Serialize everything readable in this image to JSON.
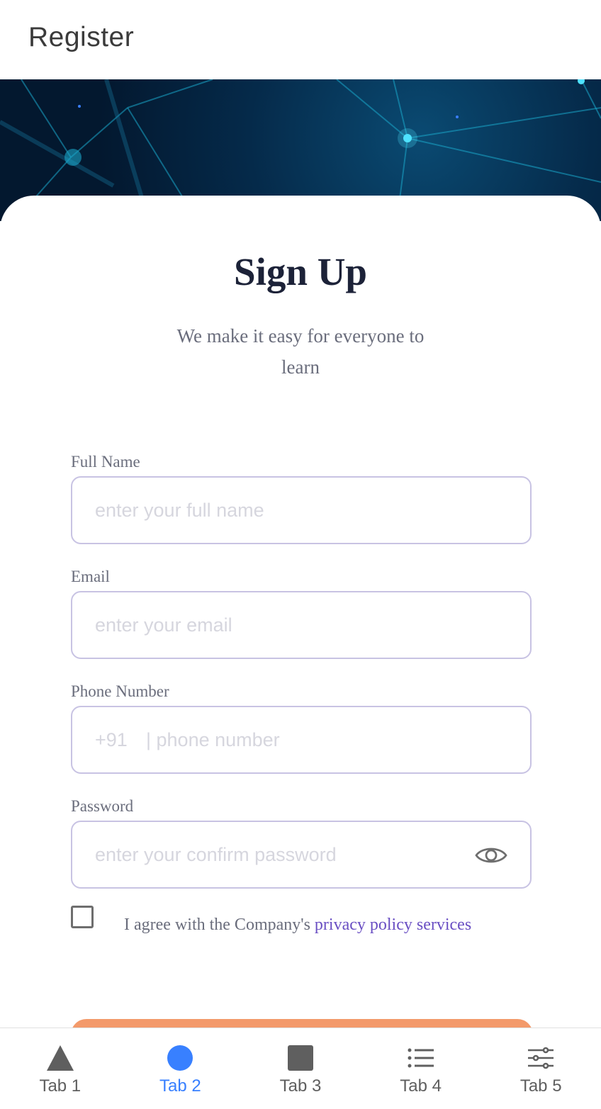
{
  "header": {
    "title": "Register"
  },
  "form": {
    "heading": "Sign Up",
    "subtitle": "We make it easy for everyone to learn",
    "full_name": {
      "label": "Full Name",
      "placeholder": "enter your full name"
    },
    "email": {
      "label": "Email",
      "placeholder": "enter your email"
    },
    "phone": {
      "label": "Phone Number",
      "prefix": "+91",
      "placeholder": "| phone number"
    },
    "password": {
      "label": "Password",
      "placeholder": "enter your confirm password",
      "toggle_icon": "eye-icon"
    },
    "agree": {
      "text": "I agree with the Company's ",
      "link": "privacy policy services",
      "checked": false
    }
  },
  "colors": {
    "accent_button": "#f39a6a",
    "link": "#6a4fc3",
    "tab_active": "#3880ff",
    "input_border": "#c8c3e3"
  },
  "tabs": [
    {
      "label": "Tab 1",
      "icon": "triangle-icon",
      "active": false
    },
    {
      "label": "Tab 2",
      "icon": "circle-icon",
      "active": true
    },
    {
      "label": "Tab 3",
      "icon": "square-icon",
      "active": false
    },
    {
      "label": "Tab 4",
      "icon": "list-icon",
      "active": false
    },
    {
      "label": "Tab 5",
      "icon": "sliders-icon",
      "active": false
    }
  ]
}
